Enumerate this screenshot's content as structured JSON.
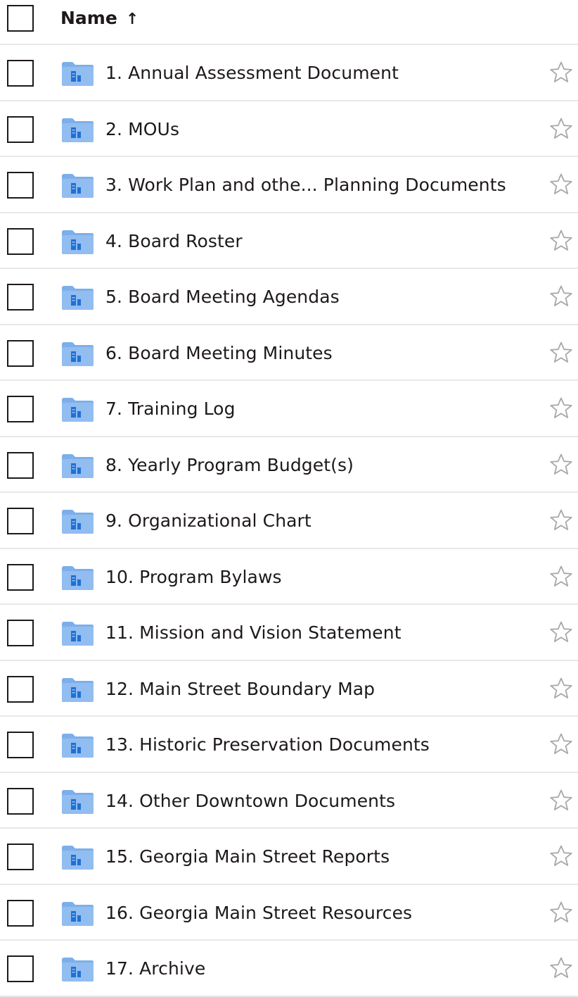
{
  "header": {
    "name_label": "Name",
    "sort_arrow": "↑"
  },
  "colors": {
    "folder_body": "#92bdf0",
    "folder_tab": "#7cafea",
    "folder_glyph": "#1f70d6",
    "star_stroke": "#a8a8a8",
    "divider": "#e6e8eb",
    "text": "#1e1919"
  },
  "icons": {
    "folder": "shared-folder-icon",
    "star": "star-outline-icon"
  },
  "rows": [
    {
      "name": "1. Annual Assessment Document"
    },
    {
      "name": "2. MOUs"
    },
    {
      "name": "3. Work Plan and othe... Planning Documents"
    },
    {
      "name": "4. Board Roster"
    },
    {
      "name": "5. Board Meeting Agendas"
    },
    {
      "name": "6. Board Meeting Minutes"
    },
    {
      "name": "7. Training Log"
    },
    {
      "name": "8. Yearly Program Budget(s)"
    },
    {
      "name": "9. Organizational Chart"
    },
    {
      "name": "10. Program Bylaws"
    },
    {
      "name": "11. Mission and Vision Statement"
    },
    {
      "name": "12. Main Street Boundary Map"
    },
    {
      "name": "13. Historic Preservation Documents"
    },
    {
      "name": "14. Other Downtown Documents"
    },
    {
      "name": "15. Georgia Main Street Reports"
    },
    {
      "name": "16. Georgia Main Street Resources"
    },
    {
      "name": "17. Archive"
    }
  ]
}
